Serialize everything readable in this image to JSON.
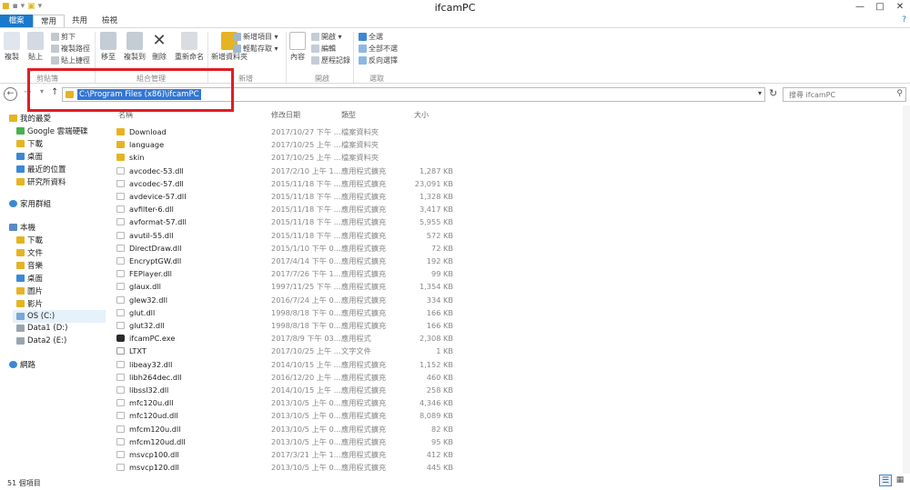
{
  "window": {
    "title": "ifcamPC",
    "minimize": "—",
    "maximize": "□",
    "close": "✕"
  },
  "qat": {
    "items": [
      "▪",
      "▾",
      "▣",
      "▾"
    ]
  },
  "tabs": [
    {
      "label": "檔案"
    },
    {
      "label": "常用"
    },
    {
      "label": "共用"
    },
    {
      "label": "檢視"
    }
  ],
  "help": "?",
  "ribbon": {
    "groups": {
      "clipboard": "剪貼簿",
      "organize": "組合管理",
      "new": "新增",
      "open": "開啟",
      "select": "選取"
    },
    "copy": "複製",
    "paste": "貼上",
    "cut": "剪下",
    "copy_path": "複製路徑",
    "paste_shortcut": "貼上捷徑",
    "move_to": "移至",
    "copy_to": "複製到",
    "delete": "刪除",
    "rename": "重新命名",
    "new_folder": "新增資料夾",
    "new_item": "新增項目 ▾",
    "easy_access": "輕鬆存取 ▾",
    "properties": "內容",
    "open": "開啟 ▾",
    "edit": "編輯",
    "history": "歷程記錄",
    "select_all": "全選",
    "select_none": "全部不選",
    "invert": "反向選擇"
  },
  "address": {
    "path": "C:\\Program Files (x86)\\ifcamPC",
    "back": "←",
    "forward": "→",
    "recent": "▾",
    "up": "↑",
    "dropdown": "▾",
    "refresh": "↻"
  },
  "search": {
    "placeholder": "搜尋 ifcamPC",
    "icon": "⚲"
  },
  "nav": {
    "favorites": "我的最愛",
    "fav_items": [
      "Google 雲端硬碟",
      "下載",
      "桌面",
      "最近的位置",
      "研究所資料"
    ],
    "homegroup": "家用群組",
    "thispc": "本機",
    "pc_items": [
      "下載",
      "文件",
      "音樂",
      "桌面",
      "圖片",
      "影片"
    ],
    "drives": [
      "OS (C:)",
      "Data1 (D:)",
      "Data2 (E:)"
    ],
    "network": "網路"
  },
  "columns": {
    "name": "名稱",
    "date": "修改日期",
    "type": "類型",
    "size": "大小"
  },
  "files": [
    {
      "name": "Download",
      "date": "2017/10/27 下午 ...",
      "type": "檔案資料夾",
      "size": "",
      "kind": "folder"
    },
    {
      "name": "language",
      "date": "2017/10/25 上午 ...",
      "type": "檔案資料夾",
      "size": "",
      "kind": "folder"
    },
    {
      "name": "skin",
      "date": "2017/10/25 上午 ...",
      "type": "檔案資料夾",
      "size": "",
      "kind": "folder"
    },
    {
      "name": "avcodec-53.dll",
      "date": "2017/2/10 上午 1...",
      "type": "應用程式擴充",
      "size": "1,287 KB",
      "kind": "dll"
    },
    {
      "name": "avcodec-57.dll",
      "date": "2015/11/18 下午 ...",
      "type": "應用程式擴充",
      "size": "23,091 KB",
      "kind": "dll"
    },
    {
      "name": "avdevice-57.dll",
      "date": "2015/11/18 下午 ...",
      "type": "應用程式擴充",
      "size": "1,328 KB",
      "kind": "dll"
    },
    {
      "name": "avfilter-6.dll",
      "date": "2015/11/18 下午 ...",
      "type": "應用程式擴充",
      "size": "3,417 KB",
      "kind": "dll"
    },
    {
      "name": "avformat-57.dll",
      "date": "2015/11/18 下午 ...",
      "type": "應用程式擴充",
      "size": "5,955 KB",
      "kind": "dll"
    },
    {
      "name": "avutil-55.dll",
      "date": "2015/11/18 下午 ...",
      "type": "應用程式擴充",
      "size": "572 KB",
      "kind": "dll"
    },
    {
      "name": "DirectDraw.dll",
      "date": "2015/1/10 下午 0...",
      "type": "應用程式擴充",
      "size": "72 KB",
      "kind": "dll"
    },
    {
      "name": "EncryptGW.dll",
      "date": "2017/4/14 下午 0...",
      "type": "應用程式擴充",
      "size": "192 KB",
      "kind": "dll"
    },
    {
      "name": "FEPlayer.dll",
      "date": "2017/7/26 下午 1...",
      "type": "應用程式擴充",
      "size": "99 KB",
      "kind": "dll"
    },
    {
      "name": "glaux.dll",
      "date": "1997/11/25 下午 ...",
      "type": "應用程式擴充",
      "size": "1,354 KB",
      "kind": "dll"
    },
    {
      "name": "glew32.dll",
      "date": "2016/7/24 上午 0...",
      "type": "應用程式擴充",
      "size": "334 KB",
      "kind": "dll"
    },
    {
      "name": "glut.dll",
      "date": "1998/8/18 下午 0...",
      "type": "應用程式擴充",
      "size": "166 KB",
      "kind": "dll"
    },
    {
      "name": "glut32.dll",
      "date": "1998/8/18 下午 0...",
      "type": "應用程式擴充",
      "size": "166 KB",
      "kind": "dll"
    },
    {
      "name": "ifcamPC.exe",
      "date": "2017/8/9 下午 03...",
      "type": "應用程式",
      "size": "2,308 KB",
      "kind": "exe"
    },
    {
      "name": "LTXT",
      "date": "2017/10/25 上午 ...",
      "type": "文字文件",
      "size": "1 KB",
      "kind": "txt"
    },
    {
      "name": "libeay32.dll",
      "date": "2014/10/15 上午 ...",
      "type": "應用程式擴充",
      "size": "1,152 KB",
      "kind": "dll"
    },
    {
      "name": "libh264dec.dll",
      "date": "2016/12/20 上午 ...",
      "type": "應用程式擴充",
      "size": "460 KB",
      "kind": "dll"
    },
    {
      "name": "libssl32.dll",
      "date": "2014/10/15 上午 ...",
      "type": "應用程式擴充",
      "size": "258 KB",
      "kind": "dll"
    },
    {
      "name": "mfc120u.dll",
      "date": "2013/10/5 上午 0...",
      "type": "應用程式擴充",
      "size": "4,346 KB",
      "kind": "dll"
    },
    {
      "name": "mfc120ud.dll",
      "date": "2013/10/5 上午 0...",
      "type": "應用程式擴充",
      "size": "8,089 KB",
      "kind": "dll"
    },
    {
      "name": "mfcm120u.dll",
      "date": "2013/10/5 上午 0...",
      "type": "應用程式擴充",
      "size": "82 KB",
      "kind": "dll"
    },
    {
      "name": "mfcm120ud.dll",
      "date": "2013/10/5 上午 0...",
      "type": "應用程式擴充",
      "size": "95 KB",
      "kind": "dll"
    },
    {
      "name": "msvcp100.dll",
      "date": "2017/3/21 上午 1...",
      "type": "應用程式擴充",
      "size": "412 KB",
      "kind": "dll"
    },
    {
      "name": "msvcp120.dll",
      "date": "2013/10/5 上午 0...",
      "type": "應用程式擴充",
      "size": "445 KB",
      "kind": "dll"
    }
  ],
  "status": {
    "count": "51 個項目"
  },
  "view": {
    "details": "☰",
    "icons": "▦"
  },
  "colors": {
    "accent": "#1979ca",
    "highlight": "#e11c24",
    "folder": "#e6b422",
    "selection": "#3277d3"
  }
}
